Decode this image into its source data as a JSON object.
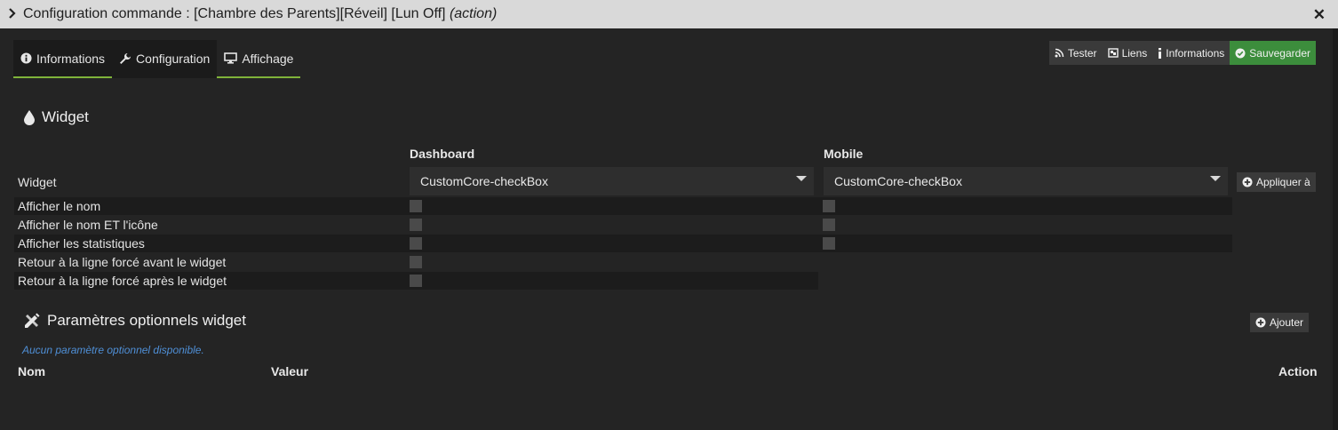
{
  "window": {
    "title_main": "Configuration commande : [Chambre des Parents][Réveil] [Lun Off]",
    "title_suffix": "(action)"
  },
  "tabs": [
    {
      "label": "Informations",
      "icon": "info-circle-icon"
    },
    {
      "label": "Configuration",
      "icon": "wrench-icon"
    },
    {
      "label": "Affichage",
      "icon": "desktop-icon",
      "active": true
    }
  ],
  "toolbar": {
    "tester": "Tester",
    "liens": "Liens",
    "informations": "Informations",
    "sauvegarder": "Sauvegarder"
  },
  "widget_section": {
    "title": "Widget",
    "col_dashboard": "Dashboard",
    "col_mobile": "Mobile",
    "widget_label": "Widget",
    "dashboard_widget": "CustomCore-checkBox",
    "mobile_widget": "CustomCore-checkBox",
    "apply_label": "Appliquer à",
    "rows": [
      {
        "label": "Afficher le nom",
        "dashboard": false,
        "mobile": false
      },
      {
        "label": "Afficher le nom ET l'icône",
        "dashboard": false,
        "mobile": false
      },
      {
        "label": "Afficher les statistiques",
        "dashboard": false,
        "mobile": false
      },
      {
        "label": "Retour à la ligne forcé avant le widget",
        "dashboard": false
      },
      {
        "label": "Retour à la ligne forcé après le widget",
        "dashboard": false
      }
    ]
  },
  "optional_section": {
    "title": "Paramètres optionnels widget",
    "add_label": "Ajouter",
    "empty_note": "Aucun paramètre optionnel disponible.",
    "col_nom": "Nom",
    "col_valeur": "Valeur",
    "col_action": "Action"
  },
  "colors": {
    "accent_tab": "#7fb33a",
    "save_button": "#3c8d3c",
    "note_text": "#4f8fd6",
    "background": "#242424"
  }
}
